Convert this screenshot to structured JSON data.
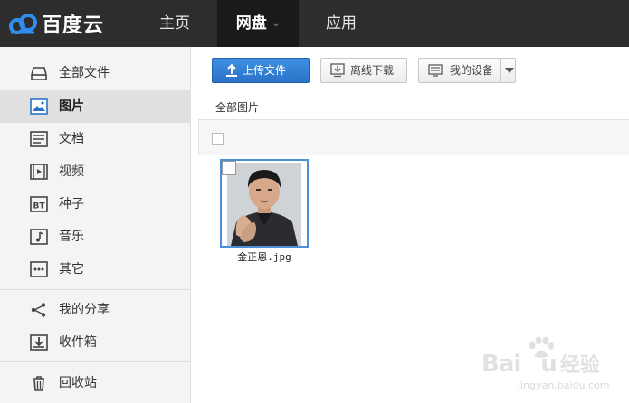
{
  "topbar": {
    "logo_text": "百度云",
    "nav": [
      {
        "label": "主页"
      },
      {
        "label": "网盘",
        "caret": "⌄"
      },
      {
        "label": "应用"
      }
    ]
  },
  "sidebar": {
    "items": [
      {
        "label": "全部文件",
        "icon": "drive-icon"
      },
      {
        "label": "图片",
        "icon": "image-icon",
        "active": true
      },
      {
        "label": "文档",
        "icon": "document-icon"
      },
      {
        "label": "视频",
        "icon": "video-icon"
      },
      {
        "label": "种子",
        "icon": "bt-icon",
        "badge": "BT"
      },
      {
        "label": "音乐",
        "icon": "music-icon"
      },
      {
        "label": "其它",
        "icon": "more-icon"
      },
      {
        "label": "我的分享",
        "icon": "share-icon"
      },
      {
        "label": "收件箱",
        "icon": "inbox-icon"
      },
      {
        "label": "回收站",
        "icon": "trash-icon"
      }
    ]
  },
  "toolbar": {
    "upload_label": "上传文件",
    "offline_label": "离线下载",
    "device_label": "我的设备"
  },
  "breadcrumb": "全部图片",
  "files": [
    {
      "name": "金正恩.jpg",
      "type": "image"
    }
  ],
  "watermark": {
    "brand_latin": "Bai",
    "brand_latin2": "u",
    "brand_cn": "经验",
    "url": "jingyan.baidu.com"
  },
  "colors": {
    "topbar_bg": "#2d2d2d",
    "accent_blue": "#2a72c8",
    "sidebar_bg": "#f4f4f4",
    "selection_border": "#4b8fd6"
  }
}
